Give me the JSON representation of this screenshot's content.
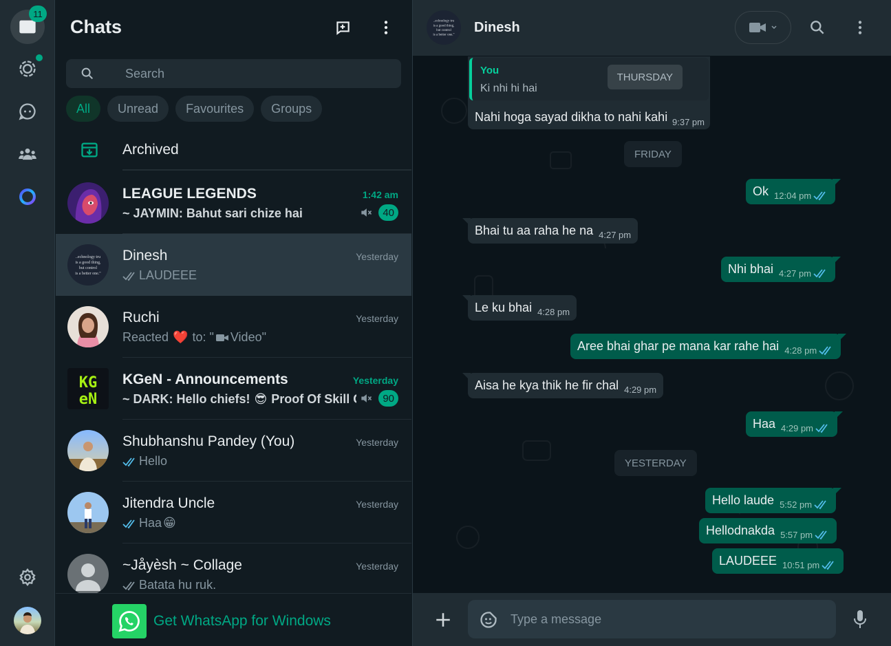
{
  "rail": {
    "chats_badge": "11"
  },
  "sidebar": {
    "title": "Chats",
    "search_placeholder": "Search",
    "filters": [
      "All",
      "Unread",
      "Favourites",
      "Groups"
    ],
    "archived_label": "Archived",
    "get_app_label": "Get WhatsApp for Windows"
  },
  "chats": [
    {
      "name": "LEAGUE LEGENDS",
      "preview": "~ JAYMIN: Bahut sari chize hai",
      "time": "1:42 am",
      "unread": "40"
    },
    {
      "name": "Dinesh",
      "preview": "LAUDEEE",
      "time": "Yesterday"
    },
    {
      "name": "Ruchi",
      "preview_a": "Reacted",
      "preview_emoji": "❤️",
      "preview_b": "to: \"",
      "preview_c": "Video\"",
      "time": "Yesterday"
    },
    {
      "name": "KGeN - Announcements",
      "preview_a": "~ DARK: Hello chiefs!",
      "preview_emoji": "😎",
      "preview_b": "Proof Of Skill Gr...",
      "time": "Yesterday",
      "unread": "90"
    },
    {
      "name": "Shubhanshu Pandey (You)",
      "preview": "Hello",
      "time": "Yesterday"
    },
    {
      "name": "Jitendra Uncle",
      "preview": "Haa",
      "preview_emoji": "😁",
      "time": "Yesterday"
    },
    {
      "name": "~Jåyèsh ~ Collage",
      "preview": "Batata hu ruk.",
      "time": "Yesterday"
    }
  ],
  "conversation": {
    "contact_name": "Dinesh",
    "composer_placeholder": "Type a message",
    "quoted": {
      "author": "You",
      "text": "Ki nhi hi hai",
      "day_chip": "THURSDAY",
      "reply_text": "Nahi hoga sayad dikha to nahi kahi",
      "reply_time": "9:37 pm"
    },
    "day_labels": [
      "FRIDAY",
      "YESTERDAY"
    ],
    "messages": [
      {
        "text": "Ok",
        "time": "12:04 pm"
      },
      {
        "text": "Bhai tu aa raha he na",
        "time": "4:27 pm"
      },
      {
        "text": "Nhi bhai",
        "time": "4:27 pm"
      },
      {
        "text": "Le ku bhai",
        "time": "4:28 pm"
      },
      {
        "text": "Aree bhai ghar pe mana kar rahe hai",
        "time": "4:28 pm"
      },
      {
        "text": "Aisa he kya thik he fir chal",
        "time": "4:29 pm"
      },
      {
        "text": "Haa",
        "time": "4:29 pm"
      },
      {
        "text": "Hello laude",
        "time": "5:52 pm"
      },
      {
        "text": "Hellodnakda",
        "time": "5:57 pm"
      },
      {
        "text": "LAUDEEE",
        "time": "10:51 pm"
      }
    ]
  },
  "colors": {
    "accent": "#00a884",
    "bubble_out": "#005c4b",
    "bubble_in": "#202c33",
    "read_tick": "#53bdeb"
  }
}
